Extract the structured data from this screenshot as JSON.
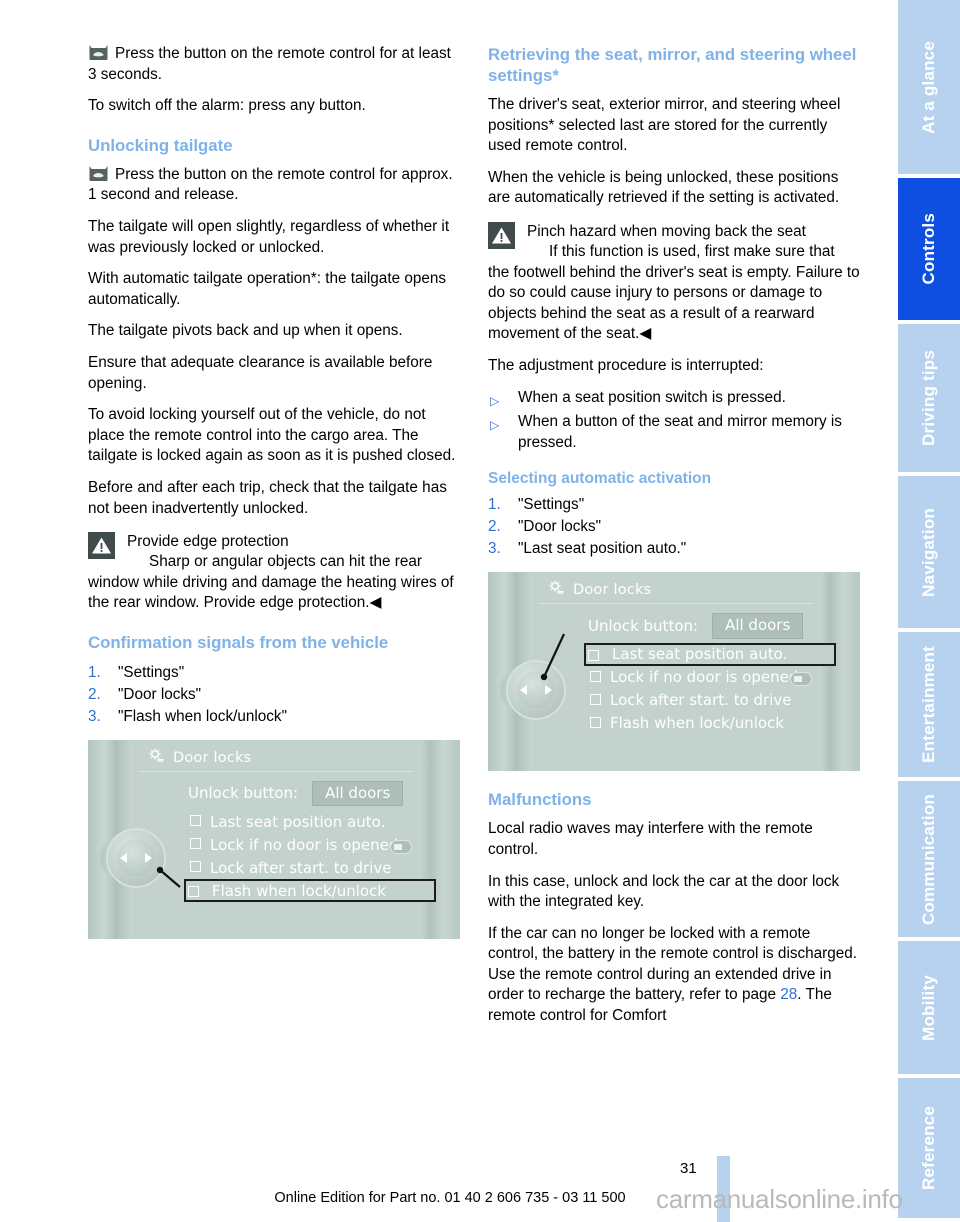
{
  "page": {
    "number": "31",
    "footer": "Online Edition for Part no. 01 40 2 606 735 - 03 11 500",
    "watermark": "carmanualsonline.info"
  },
  "sidebar": {
    "tabs": [
      {
        "label": "At a glance",
        "active": false
      },
      {
        "label": "Controls",
        "active": true
      },
      {
        "label": "Driving tips",
        "active": false
      },
      {
        "label": "Navigation",
        "active": false
      },
      {
        "label": "Entertainment",
        "active": false
      },
      {
        "label": "Communication",
        "active": false
      },
      {
        "label": "Mobility",
        "active": false
      },
      {
        "label": "Reference",
        "active": false
      }
    ],
    "active_color": "#0e4fe1",
    "inactive_color": "#b7d2ef"
  },
  "left_column": {
    "intro_para_1": "Press the button on the remote control for at least 3 seconds.",
    "intro_para_2": "To switch off the alarm: press any button.",
    "heading_unlocking_tailgate": "Unlocking tailgate",
    "p1": "Press the button on the remote control for approx. 1 second and release.",
    "p2": "The tailgate will open slightly, regardless of whether it was previously locked or unlocked.",
    "p3": "With automatic tailgate operation*: the tailgate opens automatically.",
    "p4": "The tailgate pivots back and up when it opens.",
    "p5": "Ensure that adequate clearance is available before opening.",
    "p6": "To avoid locking yourself out of the vehicle, do not place the remote control into the cargo area. The tailgate is locked again as soon as it is pushed closed.",
    "p7": "Before and after each trip, check that the tailgate has not been inadvertently unlocked.",
    "warning": {
      "title": "Provide edge protection",
      "text": "Sharp or angular objects can hit the rear window while driving and damage the heating wires of the rear window. Provide edge protection.◀"
    },
    "heading_confirmation": "Confirmation signals from the vehicle",
    "steps": [
      {
        "num": "1.",
        "label": "\"Settings\""
      },
      {
        "num": "2.",
        "label": "\"Door locks\""
      },
      {
        "num": "3.",
        "label": "\"Flash when lock/unlock\""
      }
    ]
  },
  "right_column": {
    "heading_retrieving": "Retrieving the seat, mirror, and steering wheel settings*",
    "p1": "The driver's seat, exterior mirror, and steering wheel positions* selected last are stored for the currently used remote control.",
    "p2": "When the vehicle is being unlocked, these positions are automatically retrieved if the setting is activated.",
    "warning": {
      "title": "Pinch hazard when moving back the seat",
      "text": "If this function is used, first make sure that the footwell behind the driver's seat is empty. Failure to do so could cause injury to persons or damage to objects behind the seat as a result of a rearward movement of the seat.◀"
    },
    "p3": "The adjustment procedure is interrupted:",
    "bullets": [
      "When a seat position switch is pressed.",
      "When a button of the seat and mirror memory is pressed."
    ],
    "heading_selecting": "Selecting automatic activation",
    "steps": [
      {
        "num": "1.",
        "label": "\"Settings\""
      },
      {
        "num": "2.",
        "label": "\"Door locks\""
      },
      {
        "num": "3.",
        "label": "\"Last seat position auto.\""
      }
    ],
    "heading_malfunctions": "Malfunctions",
    "m1": "Local radio waves may interfere with the remote control.",
    "m2": "In this case, unlock and lock the car at the door lock with the integrated key.",
    "m3_part1": "If the car can no longer be locked with a remote control, the battery in the remote control is discharged. Use the remote control during an extended drive in order to recharge the battery, refer to page ",
    "m3_link": "28",
    "m3_part2": ". The remote control for Comfort"
  },
  "idrive_left": {
    "title": "Door locks",
    "unlock_label": "Unlock button:",
    "unlock_value": "All doors",
    "items": [
      {
        "label": "Last seat position auto.",
        "selected": false
      },
      {
        "label": "Lock if no door is opened",
        "selected": false
      },
      {
        "label": "Lock after start. to drive",
        "selected": false
      },
      {
        "label": "Flash when lock/unlock",
        "selected": true
      }
    ]
  },
  "idrive_right": {
    "title": "Door locks",
    "unlock_label": "Unlock button:",
    "unlock_value": "All doors",
    "items": [
      {
        "label": "Last seat position auto.",
        "selected": true
      },
      {
        "label": "Lock if no door is opened",
        "selected": false
      },
      {
        "label": "Lock after start. to drive",
        "selected": false
      },
      {
        "label": "Flash when lock/unlock",
        "selected": false
      }
    ]
  }
}
